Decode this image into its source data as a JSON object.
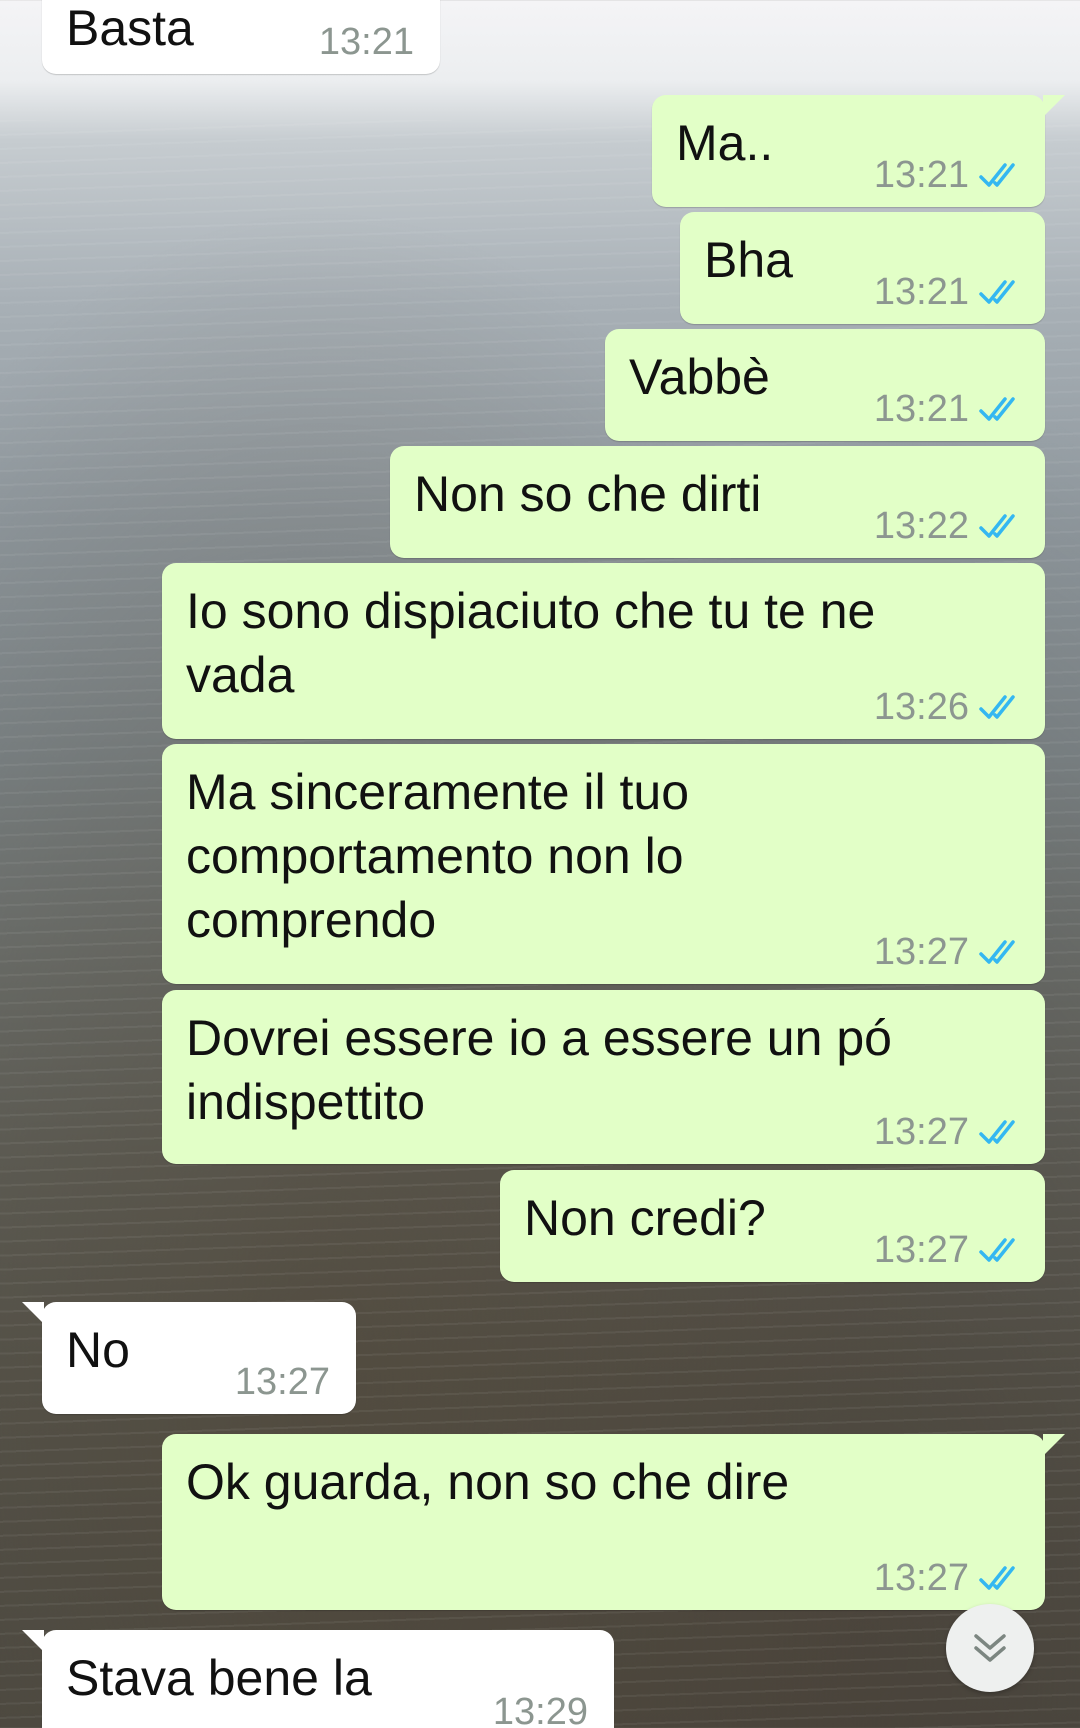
{
  "messages": [
    {
      "text": "Basta",
      "time": "13:21",
      "direction": "in",
      "read": false
    },
    {
      "text": "Ma..",
      "time": "13:21",
      "direction": "out",
      "read": true
    },
    {
      "text": "Bha",
      "time": "13:21",
      "direction": "out",
      "read": true
    },
    {
      "text": "Vabbè",
      "time": "13:21",
      "direction": "out",
      "read": true
    },
    {
      "text": "Non so che dirti",
      "time": "13:22",
      "direction": "out",
      "read": true
    },
    {
      "text": "Io sono dispiaciuto che tu te ne\nvada",
      "time": "13:26",
      "direction": "out",
      "read": true
    },
    {
      "text": "Ma sinceramente il tuo\ncomportamento non lo\ncomprendo",
      "time": "13:27",
      "direction": "out",
      "read": true
    },
    {
      "text": "Dovrei essere io a essere un pó\nindispettito",
      "time": "13:27",
      "direction": "out",
      "read": true
    },
    {
      "text": "Non credi?",
      "time": "13:27",
      "direction": "out",
      "read": true
    },
    {
      "text": "No",
      "time": "13:27",
      "direction": "in",
      "read": false
    },
    {
      "text": "Ok guarda, non so che dire",
      "time": "13:27",
      "direction": "out",
      "read": true
    },
    {
      "text": "Stava bene la",
      "time": "13:29",
      "direction": "in",
      "read": false
    }
  ],
  "colors": {
    "outgoing_bubble": "#e2ffc7",
    "incoming_bubble": "#ffffff",
    "timestamp": "#8c9690",
    "read_ticks": "#34b7f1"
  },
  "icons": {
    "read_receipt": "double-check-icon",
    "scroll_down": "chevron-double-down-icon"
  }
}
